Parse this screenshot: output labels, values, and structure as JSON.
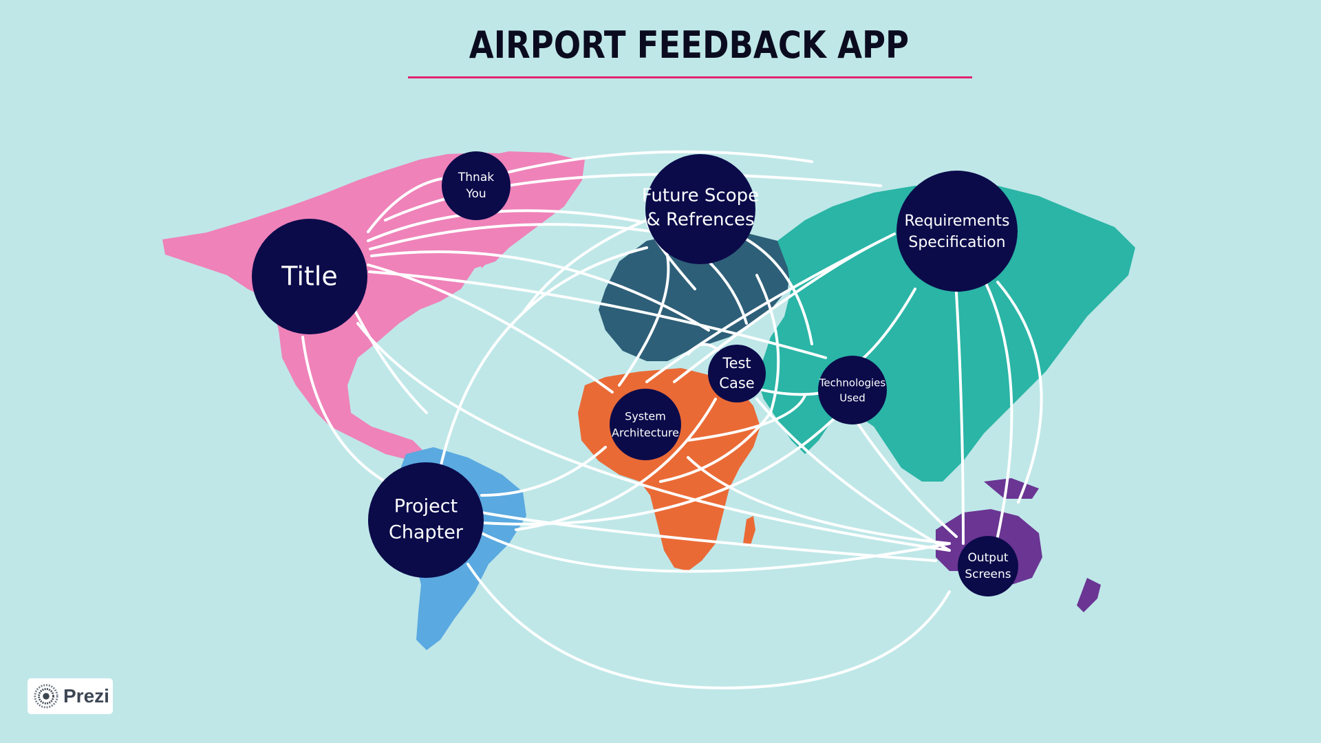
{
  "header": {
    "title": "AIRPORT FEEDBACK APP"
  },
  "colors": {
    "background": "#bfe7e8",
    "accent_rule": "#e0246e",
    "node": "#0b0b4a",
    "north_america": "#ef82b9",
    "south_america": "#5aa9e0",
    "europe": "#2e5f78",
    "africa": "#ea6a36",
    "asia": "#2ab5a6",
    "oceania": "#6a3593"
  },
  "nodes": [
    {
      "id": "title",
      "lines": [
        "Title"
      ]
    },
    {
      "id": "thank-you",
      "lines": [
        "Thnak",
        "You"
      ]
    },
    {
      "id": "future-scope",
      "lines": [
        "Future Scope",
        "& Refrences"
      ]
    },
    {
      "id": "requirements",
      "lines": [
        "Requirements",
        "Specification"
      ]
    },
    {
      "id": "test-case",
      "lines": [
        "Test",
        "Case"
      ]
    },
    {
      "id": "technologies",
      "lines": [
        "Technologies",
        "Used"
      ]
    },
    {
      "id": "system-architecture",
      "lines": [
        "System",
        "Architecture"
      ]
    },
    {
      "id": "project-chapter",
      "lines": [
        "Project",
        "Chapter"
      ]
    },
    {
      "id": "output-screens",
      "lines": [
        "Output",
        "Screens"
      ]
    }
  ],
  "brand": {
    "name": "Prezi",
    "icon": "prezi-logo-icon"
  }
}
